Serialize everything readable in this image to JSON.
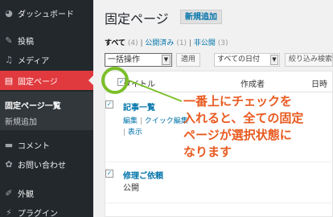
{
  "sidebar": {
    "items": [
      {
        "label": "ダッシュボード",
        "icon": "dashboard-icon",
        "glyph": "◕"
      },
      {
        "label": "投稿",
        "icon": "pin-icon",
        "glyph": "✎"
      },
      {
        "label": "メディア",
        "icon": "media-icon",
        "glyph": "♫"
      },
      {
        "label": "固定ページ",
        "icon": "pages-icon",
        "glyph": "▤"
      },
      {
        "label": "コメント",
        "icon": "comment-icon",
        "glyph": "▬"
      },
      {
        "label": "お問い合わせ",
        "icon": "gear-icon",
        "glyph": "✿"
      },
      {
        "label": "外観",
        "icon": "appearance-icon",
        "glyph": "✐"
      },
      {
        "label": "プラグイン",
        "icon": "plugin-icon",
        "glyph": "⚡"
      }
    ],
    "submenu": {
      "current": "固定ページ一覧",
      "add": "新規追加"
    }
  },
  "main": {
    "title": "固定ページ",
    "add_new": "新規追加",
    "filters": {
      "all": "すべて",
      "all_count": "(4)",
      "published": "公開済み",
      "published_count": "(1)",
      "private": "非公開",
      "private_count": "(3)"
    },
    "bulk_action": "一括操作",
    "apply": "適用",
    "date_filter": "すべての日付",
    "filter_button": "絞り込み検索",
    "columns": {
      "title": "タイトル",
      "author": "作成者",
      "date": "日時"
    },
    "rows": [
      {
        "title": "記事一覧",
        "actions": [
          "編集",
          "クイック編集"
        ],
        "extra": "表示"
      },
      {
        "title": "修理ご依頼",
        "status": "公開"
      }
    ]
  },
  "annotation": {
    "lines": [
      "一番上にチェックを",
      "入れると、全ての固定",
      "ページが選択状態に",
      "なります"
    ],
    "ring_color": "#7cbf2a",
    "text_color": "#e85a20"
  },
  "colors": {
    "active_menu": "#e0393e",
    "sidebar": "#23282d",
    "link": "#0073aa"
  }
}
